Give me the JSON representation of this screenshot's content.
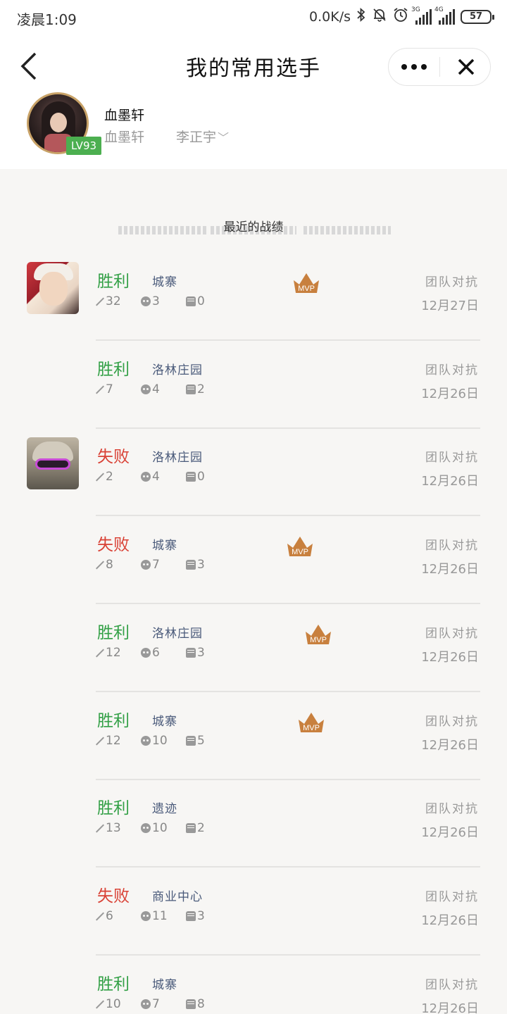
{
  "status_bar": {
    "time": "凌晨1:09",
    "speed": "0.0K/s",
    "signal1_label": "3G",
    "signal2_label": "4G",
    "battery": "57"
  },
  "nav": {
    "title": "我的常用选手"
  },
  "profile": {
    "name": "血墨轩",
    "sub_name": "血墨轩",
    "player": "李正宇",
    "level": "LV93"
  },
  "section": {
    "title": "最近的战绩"
  },
  "colors": {
    "win": "#33a046",
    "lose": "#d94135",
    "mvp": "#c8803e",
    "level_badge": "#4caf50"
  },
  "matches": [
    {
      "hero": "hero-avatar-1",
      "result": "胜利",
      "outcome": "win",
      "map": "城寨",
      "kills": "32",
      "deaths": "3",
      "assists": "0",
      "mvp": true,
      "mode": "团队对抗",
      "date": "12月27日"
    },
    {
      "hero": "",
      "result": "胜利",
      "outcome": "win",
      "map": "洛林庄园",
      "kills": "7",
      "deaths": "4",
      "assists": "2",
      "mvp": false,
      "mode": "团队对抗",
      "date": "12月26日"
    },
    {
      "hero": "hero-avatar-2",
      "result": "失败",
      "outcome": "lose",
      "map": "洛林庄园",
      "kills": "2",
      "deaths": "4",
      "assists": "0",
      "mvp": false,
      "mode": "团队对抗",
      "date": "12月26日"
    },
    {
      "hero": "",
      "result": "失败",
      "outcome": "lose",
      "map": "城寨",
      "kills": "8",
      "deaths": "7",
      "assists": "3",
      "mvp": true,
      "mode": "团队对抗",
      "date": "12月26日"
    },
    {
      "hero": "",
      "result": "胜利",
      "outcome": "win",
      "map": "洛林庄园",
      "kills": "12",
      "deaths": "6",
      "assists": "3",
      "mvp": true,
      "mode": "团队对抗",
      "date": "12月26日"
    },
    {
      "hero": "",
      "result": "胜利",
      "outcome": "win",
      "map": "城寨",
      "kills": "12",
      "deaths": "10",
      "assists": "5",
      "mvp": true,
      "mode": "团队对抗",
      "date": "12月26日"
    },
    {
      "hero": "",
      "result": "胜利",
      "outcome": "win",
      "map": "遗迹",
      "kills": "13",
      "deaths": "10",
      "assists": "2",
      "mvp": false,
      "mode": "团队对抗",
      "date": "12月26日"
    },
    {
      "hero": "",
      "result": "失败",
      "outcome": "lose",
      "map": "商业中心",
      "kills": "6",
      "deaths": "11",
      "assists": "3",
      "mvp": false,
      "mode": "团队对抗",
      "date": "12月26日"
    },
    {
      "hero": "",
      "result": "胜利",
      "outcome": "win",
      "map": "城寨",
      "kills": "10",
      "deaths": "7",
      "assists": "8",
      "mvp": false,
      "mode": "团队对抗",
      "date": "12月26日"
    }
  ]
}
